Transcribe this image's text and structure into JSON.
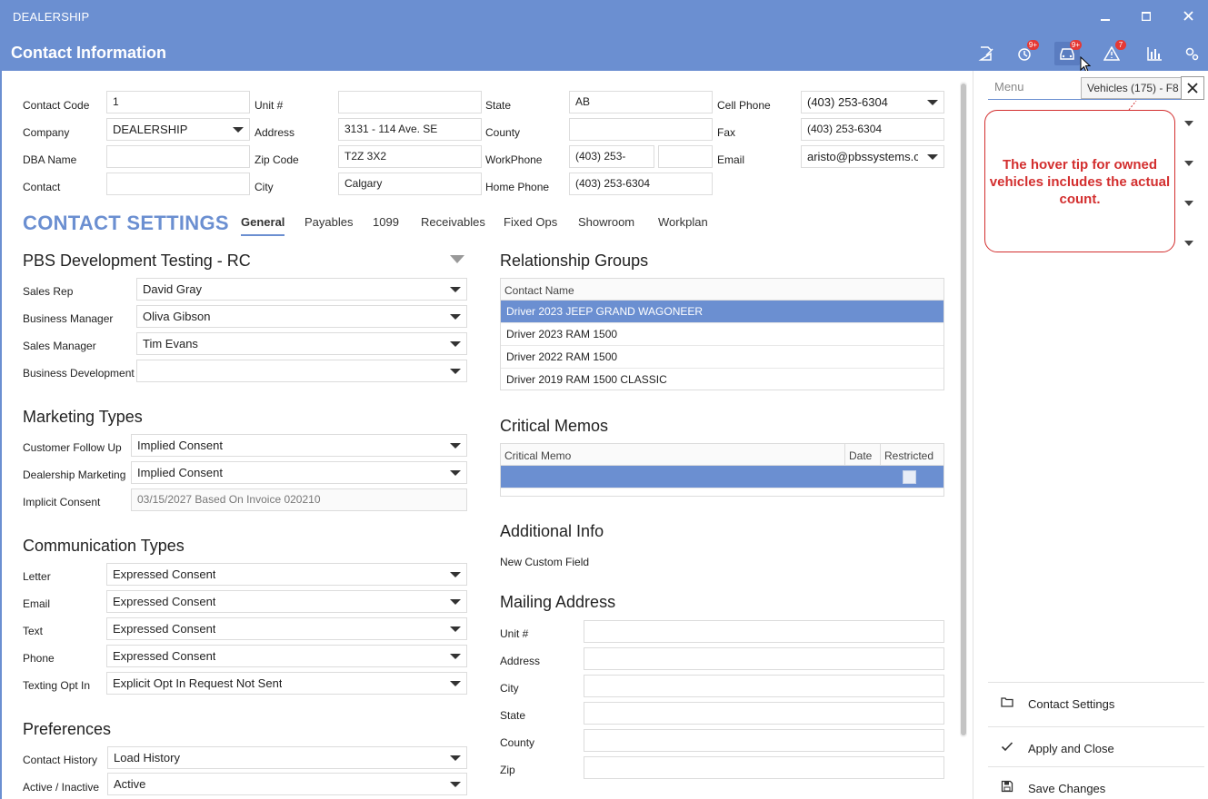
{
  "app": {
    "title": "DEALERSHIP",
    "page_title": "Contact Information"
  },
  "header_icons": [
    {
      "name": "edit-icon",
      "badge": ""
    },
    {
      "name": "history-icon",
      "badge": "9+"
    },
    {
      "name": "car-icon",
      "badge": "9+"
    },
    {
      "name": "warning-icon",
      "badge": "7"
    },
    {
      "name": "bar-chart-icon",
      "badge": ""
    },
    {
      "name": "settings-icon",
      "badge": ""
    }
  ],
  "contact": {
    "contact_code_label": "Contact Code",
    "contact_code": "1",
    "company_label": "Company",
    "company": "DEALERSHIP",
    "dba_label": "DBA Name",
    "dba": "",
    "contact_label": "Contact",
    "contact": "",
    "unit_label": "Unit #",
    "unit": "",
    "address_label": "Address",
    "address": "3131 - 114 Ave. SE",
    "zip_label": "Zip Code",
    "zip": "T2Z 3X2",
    "city_label": "City",
    "city": "Calgary",
    "state_label": "State",
    "state": "AB",
    "county_label": "County",
    "county": "",
    "workphone_label": "WorkPhone",
    "workphone": "(403) 253-",
    "workphone_ext": "",
    "homephone_label": "Home Phone",
    "homephone": "(403) 253-6304",
    "cell_label": "Cell Phone",
    "cell": "(403) 253-6304",
    "fax_label": "Fax",
    "fax": "(403) 253-6304",
    "email_label": "Email",
    "email": "aristo@pbssystems.cc"
  },
  "settings": {
    "title": "CONTACT SETTINGS",
    "tabs": [
      "General",
      "Payables",
      "1099",
      "Receivables",
      "Fixed Ops",
      "Showroom",
      "Workplan"
    ]
  },
  "pbs": {
    "title": "PBS Development Testing - RC",
    "sales_rep_label": "Sales Rep",
    "sales_rep": "David Gray",
    "business_manager_label": "Business Manager",
    "business_manager": "Oliva Gibson",
    "sales_manager_label": "Sales Manager",
    "sales_manager": "Tim Evans",
    "business_development_label": "Business Development",
    "business_development": ""
  },
  "marketing": {
    "title": "Marketing Types",
    "follow_up_label": "Customer Follow Up",
    "follow_up": "Implied Consent",
    "dealership_label": "Dealership Marketing",
    "dealership": "Implied Consent",
    "implicit_label": "Implicit Consent",
    "implicit": "03/15/2027 Based On Invoice 020210"
  },
  "communication": {
    "title": "Communication Types",
    "letter_label": "Letter",
    "letter": "Expressed Consent",
    "email_label": "Email",
    "email": "Expressed Consent",
    "text_label": "Text",
    "text": "Expressed Consent",
    "phone_label": "Phone",
    "phone": "Expressed Consent",
    "texting_label": "Texting Opt In",
    "texting": "Explicit Opt In Request Not Sent"
  },
  "preferences": {
    "title": "Preferences",
    "history_label": "Contact History",
    "history": "Load History",
    "active_label": "Active / Inactive",
    "active": "Active"
  },
  "relationship": {
    "title": "Relationship Groups",
    "column": "Contact Name",
    "rows": [
      "Driver 2023 JEEP GRAND WAGONEER",
      "Driver 2023 RAM 1500",
      "Driver 2022 RAM 1500",
      "Driver 2019 RAM 1500 CLASSIC"
    ]
  },
  "memos": {
    "title": "Critical Memos",
    "columns": [
      "Critical Memo",
      "Date",
      "Restricted"
    ]
  },
  "additional": {
    "title": "Additional Info",
    "custom_field": "New Custom Field"
  },
  "mailing": {
    "title": "Mailing Address",
    "labels": [
      "Unit #",
      "Address",
      "City",
      "State",
      "County",
      "Zip"
    ]
  },
  "side": {
    "search_placeholder": "Menu",
    "tooltip": "Vehicles (175) - F8",
    "callout": "The hover tip for owned vehicles includes the actual count.",
    "items": [
      "Contact Settings",
      "Apply and Close",
      "Save Changes"
    ]
  },
  "colors": {
    "accent": "#6b8fd1",
    "callout": "#d32f2f",
    "badge": "#e53935"
  }
}
